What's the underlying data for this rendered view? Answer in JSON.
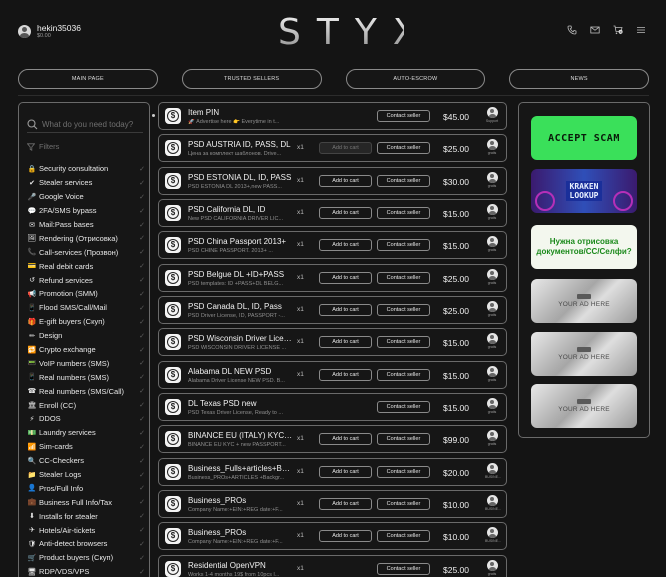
{
  "user": {
    "name": "hekin35036",
    "balance": "$0.00"
  },
  "brand": {
    "logo": "STYX"
  },
  "header_icons": [
    "phone-icon",
    "mail-icon",
    "cart-icon",
    "menu-icon"
  ],
  "cart": {
    "count": "0"
  },
  "nav": [
    {
      "label": "MAIN PAGE"
    },
    {
      "label": "TRUSTED SELLERS"
    },
    {
      "label": "AUTO-ESCROW"
    },
    {
      "label": "NEWS"
    }
  ],
  "sidebar": {
    "search_placeholder": "What do you need today?",
    "filters_label": "Filters",
    "categories": [
      {
        "icon": "🔒",
        "label": "Security consultation"
      },
      {
        "icon": "✔",
        "label": "Stealer services"
      },
      {
        "icon": "🎤",
        "label": "Google Voice"
      },
      {
        "icon": "💬",
        "label": "2FA/SMS bypass"
      },
      {
        "icon": "✉",
        "label": "Mail:Pass bases"
      },
      {
        "icon": "🖼",
        "label": "Rendering (Отрисовка)"
      },
      {
        "icon": "📞",
        "label": "Call-services (Прозвон)"
      },
      {
        "icon": "💳",
        "label": "Real debit cards"
      },
      {
        "icon": "↺",
        "label": "Refund services"
      },
      {
        "icon": "📢",
        "label": "Promotion (SMM)"
      },
      {
        "icon": "📱",
        "label": "Flood SMS/Call/Mail"
      },
      {
        "icon": "🎁",
        "label": "E-gift buyers (Скуп)"
      },
      {
        "icon": "✏",
        "label": "Design"
      },
      {
        "icon": "🔁",
        "label": "Crypto exchange"
      },
      {
        "icon": "📟",
        "label": "VoIP numbers (SMS)"
      },
      {
        "icon": "📱",
        "label": "Real numbers (SMS)"
      },
      {
        "icon": "☎",
        "label": "Real numbers (SMS/Call)"
      },
      {
        "icon": "🏛",
        "label": "Enroll (CC)"
      },
      {
        "icon": "⚡",
        "label": "DDOS"
      },
      {
        "icon": "💵",
        "label": "Laundry services"
      },
      {
        "icon": "📶",
        "label": "Sim-cards"
      },
      {
        "icon": "🔍",
        "label": "CC-Checkers"
      },
      {
        "icon": "📁",
        "label": "Stealer Logs"
      },
      {
        "icon": "👤",
        "label": "Pros/Full Info"
      },
      {
        "icon": "💼",
        "label": "Business Full Info/Tax"
      },
      {
        "icon": "⬇",
        "label": "Installs for stealer"
      },
      {
        "icon": "✈",
        "label": "Hotels/Air-tickets"
      },
      {
        "icon": "🛡",
        "label": "Anti-detect browsers"
      },
      {
        "icon": "🛒",
        "label": "Product buyers (Скуп)"
      },
      {
        "icon": "🖥",
        "label": "RDP/VDS/VPS"
      }
    ]
  },
  "listing": {
    "add_to_cart_label": "Add to cart",
    "contact_label": "Contact seller",
    "items": [
      {
        "title": "Item PIN",
        "subtitle": "🚀 Advertise here 👉 Everytime in t...",
        "qty": "",
        "price": "$45.00",
        "seller": "Support",
        "show_add": false,
        "add_disabled": false
      },
      {
        "title": "PSD AUSTRIA ID, PASS, DL",
        "subtitle": "Цена за комплект шаблонов. Drive...",
        "qty": "x1",
        "price": "$25.00",
        "seller": "gratis",
        "show_add": true,
        "add_disabled": true
      },
      {
        "title": "PSD ESTONIA DL, ID, PASS",
        "subtitle": "PSD ESTONIA DL 2013+,new PASS...",
        "qty": "x1",
        "price": "$30.00",
        "seller": "gratis",
        "show_add": true,
        "add_disabled": false
      },
      {
        "title": "PSD California DL, ID",
        "subtitle": "New PSD CALIFORNIA DRIVER LIC...",
        "qty": "x1",
        "price": "$15.00",
        "seller": "gratis",
        "show_add": true,
        "add_disabled": false
      },
      {
        "title": "PSD China Passport 2013+",
        "subtitle": "PSD CHINE PASSPORT. 2013+ ...",
        "qty": "x1",
        "price": "$15.00",
        "seller": "gratis",
        "show_add": true,
        "add_disabled": false
      },
      {
        "title": "PSD Belgue DL +ID+PASS",
        "subtitle": "PSD templates: ID +PASS+DL BELG...",
        "qty": "x1",
        "price": "$25.00",
        "seller": "gratis",
        "show_add": true,
        "add_disabled": false
      },
      {
        "title": "PSD Canada DL, ID, Pass",
        "subtitle": "PSD Driver License, ID, PASSPORT -...",
        "qty": "x1",
        "price": "$25.00",
        "seller": "gratis",
        "show_add": true,
        "add_disabled": false
      },
      {
        "title": "PSD Wisconsin Driver Licen...",
        "subtitle": "PSD WISCONSIN DRIVER LICENSE ...",
        "qty": "x1",
        "price": "$15.00",
        "seller": "gratis",
        "show_add": true,
        "add_disabled": false
      },
      {
        "title": "Alabama DL NEW PSD",
        "subtitle": "Alabama Driver License NEW PSD. B...",
        "qty": "x1",
        "price": "$15.00",
        "seller": "gratis",
        "show_add": true,
        "add_disabled": false
      },
      {
        "title": "DL Texas PSD new",
        "subtitle": "PSD Texas Driver License, Ready to ...",
        "qty": "",
        "price": "$15.00",
        "seller": "gratis",
        "show_add": false,
        "add_disabled": false
      },
      {
        "title": "BINANCE EU (ITALY) KYC +...",
        "subtitle": "BINANCE EU KYC + new PASSPORT...",
        "qty": "x1",
        "price": "$99.00",
        "seller": "gratis",
        "show_add": true,
        "add_disabled": false
      },
      {
        "title": "Business_Fulls+articles+BG...",
        "subtitle": "Business_PROs+ARTICLES +Backgr...",
        "qty": "x1",
        "price": "$20.00",
        "seller": "BUSINE...",
        "show_add": true,
        "add_disabled": false
      },
      {
        "title": "Business_PROs",
        "subtitle": "Company Name:+EIN:+REG date:+F...",
        "qty": "x1",
        "price": "$10.00",
        "seller": "BUSINE...",
        "show_add": true,
        "add_disabled": false
      },
      {
        "title": "Business_PROs",
        "subtitle": "Company Name:+EIN:+REG date:+F...",
        "qty": "x1",
        "price": "$10.00",
        "seller": "BUSINE...",
        "show_add": true,
        "add_disabled": false
      },
      {
        "title": "Residential OpenVPN",
        "subtitle": "Works 1-4 months 19$ from 10pcs l...",
        "qty": "x1",
        "price": "$25.00",
        "seller": "gratis",
        "show_add": false,
        "add_disabled": false
      }
    ]
  },
  "banners": {
    "accept_scam": "ACCEPT SCAM",
    "kraken_line1": "KRAKEN",
    "kraken_line2": "LOOKUP",
    "render_line1": "Нужна отрисовка",
    "render_line2": "документов/CC/Селфи?",
    "your_ad": "YOUR AD HERE"
  },
  "colors": {
    "accent_green": "#3ae05a",
    "background": "#141414",
    "border": "#6a6a6a"
  }
}
